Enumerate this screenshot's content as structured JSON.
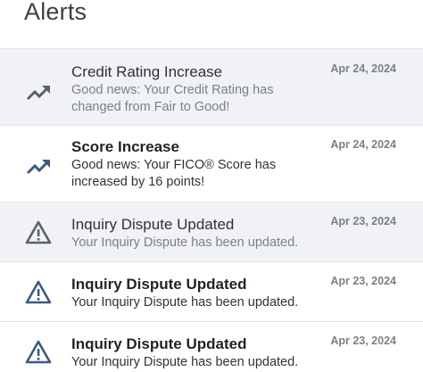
{
  "header": {
    "title": "Alerts"
  },
  "colors": {
    "icon_read": "#5b6169",
    "icon_unread": "#3c5a80",
    "row_read_bg": "#f1f2f5",
    "row_unread_bg": "#ffffff"
  },
  "alerts": [
    {
      "icon": "trending-up-icon",
      "title": "Credit Rating Increase",
      "body": "Good news: Your Credit Rating has changed from Fair to Good!",
      "date": "Apr 24, 2024",
      "read": true
    },
    {
      "icon": "trending-up-icon",
      "title": "Score Increase",
      "body": "Good news: Your FICO® Score has increased by 16 points!",
      "date": "Apr 24, 2024",
      "read": false
    },
    {
      "icon": "warning-icon",
      "title": "Inquiry Dispute Updated",
      "body": "Your Inquiry Dispute has been updated.",
      "date": "Apr 23, 2024",
      "read": true
    },
    {
      "icon": "warning-icon",
      "title": "Inquiry Dispute Updated",
      "body": "Your Inquiry Dispute has been updated.",
      "date": "Apr 23, 2024",
      "read": false
    },
    {
      "icon": "warning-icon",
      "title": "Inquiry Dispute Updated",
      "body": "Your Inquiry Dispute has been updated.",
      "date": "Apr 23, 2024",
      "read": false
    }
  ]
}
